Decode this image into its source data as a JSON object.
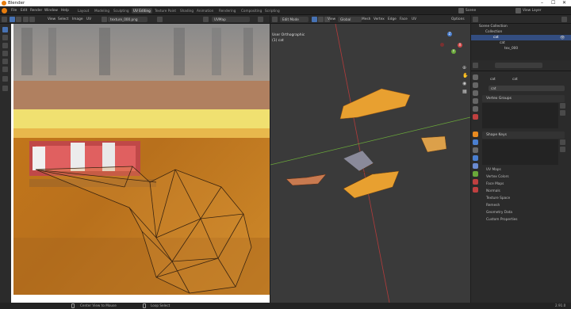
{
  "window": {
    "title": "Blender"
  },
  "menu": [
    "File",
    "Edit",
    "Render",
    "Window",
    "Help"
  ],
  "workspaces": [
    "Layout",
    "Modeling",
    "Sculpting",
    "UV Editing",
    "Texture Paint",
    "Shading",
    "Animation",
    "Rendering",
    "Compositing",
    "Scripting"
  ],
  "active_workspace": "UV Editing",
  "scene": {
    "label": "Scene",
    "view_layer": "View Layer"
  },
  "uv_editor": {
    "menus": [
      "View",
      "Select",
      "Image",
      "UV"
    ],
    "image_name": "texture_000.png",
    "uvmap_name": "UVMap"
  },
  "viewport": {
    "mode": "Edit Mode",
    "menus": [
      "View",
      "Select",
      "Add",
      "Mesh",
      "Vertex",
      "Edge",
      "Face",
      "UV"
    ],
    "orientation": "Global",
    "options_label": "Options",
    "overlay_line1": "User Orthographic",
    "overlay_line2": "(1) cat",
    "gizmo": {
      "x": "X",
      "y": "Y",
      "z": "Z"
    }
  },
  "outliner": {
    "root": "Scene Collection",
    "collection": "Collection",
    "object": "cat",
    "mesh": "cat",
    "material": "tex_000"
  },
  "properties": {
    "object_name": "cat",
    "mesh_name": "cat",
    "data_name": "cat",
    "sections": {
      "vertex_groups": "Vertex Groups",
      "shape_keys": "Shape Keys"
    },
    "collapsed": [
      "UV Maps",
      "Vertex Colors",
      "Face Maps",
      "Normals",
      "Texture Space",
      "Remesh",
      "Geometry Data",
      "Custom Properties"
    ]
  },
  "status": {
    "left": "Center View to Mouse",
    "mid": "Loop Select",
    "version": "2.91.0"
  },
  "colors": {
    "accent": "#4772b3",
    "mesh_orange": "#e8a030",
    "x_axis": "#b33b3b",
    "y_axis": "#6aa83a"
  }
}
